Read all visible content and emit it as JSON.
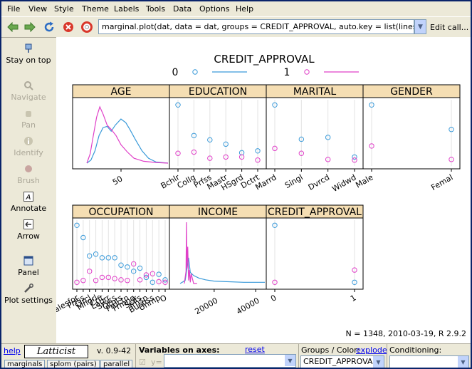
{
  "menu": [
    "File",
    "View",
    "Style",
    "Theme",
    "Labels",
    "Tools",
    "Data",
    "Options",
    "Help"
  ],
  "toolbar": {
    "call": "marginal.plot(dat, data = dat, groups = CREDIT_APPROVAL, auto.key = list(lines = TRUE,",
    "edit_call": "Edit call..."
  },
  "tools": {
    "stay_on_top": "Stay on top",
    "navigate": "Navigate",
    "pan": "Pan",
    "identify": "Identify",
    "brush": "Brush",
    "annotate": "Annotate",
    "arrow": "Arrow",
    "panel": "Panel",
    "plot_settings": "Plot settings"
  },
  "colors": {
    "group0": "#3a9ad9",
    "group1": "#e040c8",
    "strip": "#f5deb3"
  },
  "plot": {
    "legend_title": "CREDIT_APPROVAL",
    "legend_levels": [
      "0",
      "1"
    ],
    "footer": "N = 1348, 2010-03-19, R 2.9.2",
    "panels": [
      {
        "title": "AGE",
        "kind": "density",
        "ticks": [
          "50"
        ]
      },
      {
        "title": "EDUCATION",
        "kind": "dots",
        "ticks": [
          "Bchlr",
          "Collg",
          "Prfss",
          "Mastr",
          "HSgrd",
          "Dctrt"
        ],
        "v0": [
          0.95,
          0.45,
          0.38,
          0.31,
          0.17,
          0.2
        ],
        "v1": [
          0.16,
          0.18,
          0.08,
          0.1,
          0.1,
          0.05
        ]
      },
      {
        "title": "MARITAL",
        "kind": "dots",
        "ticks": [
          "Marrd",
          "Singl",
          "Dvrcd",
          "Widwd"
        ],
        "v0": [
          0.95,
          0.39,
          0.42,
          0.1
        ],
        "v1": [
          0.24,
          0.16,
          0.06,
          0.05
        ]
      },
      {
        "title": "GENDER",
        "kind": "dots",
        "ticks": [
          "Male",
          "Femal"
        ],
        "v0": [
          0.95,
          0.55
        ],
        "v1": [
          0.28,
          0.06
        ]
      },
      {
        "title": "OCCUPATION",
        "kind": "dots",
        "ticks": [
          "Salesfor",
          "Prfss",
          "Clrcl",
          "Mngrl",
          "Crft",
          "Labrr",
          "Srvcs",
          "Othrs",
          "Prdctn",
          "Frmng",
          "Sclfs",
          "Trnsp",
          "Busnss",
          "Unmp",
          "O"
        ],
        "v0": [
          0.95,
          0.75,
          0.45,
          0.48,
          0.42,
          0.42,
          0.42,
          0.3,
          0.27,
          0.2,
          0.25,
          0.1,
          0.02,
          0.15,
          0.06
        ],
        "v1": [
          0.02,
          0.05,
          0.2,
          0.05,
          0.1,
          0.1,
          0.08,
          0.06,
          0.05,
          0.32,
          0.06,
          0.14,
          0.16,
          0.03,
          0.02
        ]
      },
      {
        "title": "INCOME",
        "kind": "income",
        "ticks": [
          "20000",
          "40000"
        ]
      },
      {
        "title": "CREDIT_APPROVAL",
        "kind": "dots",
        "ticks": [
          "0",
          "1"
        ],
        "v0": [
          0.95,
          0.02
        ],
        "v1": [
          0.02,
          0.22
        ]
      }
    ]
  },
  "bottom": {
    "help": "help",
    "brand": "Latticist",
    "version": "v. 0.9-42",
    "variables_label": "Variables on axes:",
    "reset": "reset",
    "y_label": "y=",
    "groups_label": "Groups / Color:",
    "explode": "explode",
    "groups_value": "CREDIT_APPROVAL",
    "conditioning_label": "Conditioning:",
    "btn_marginals": "marginals",
    "btn_splom": "splom (pairs)",
    "btn_parallel": "parallel"
  }
}
